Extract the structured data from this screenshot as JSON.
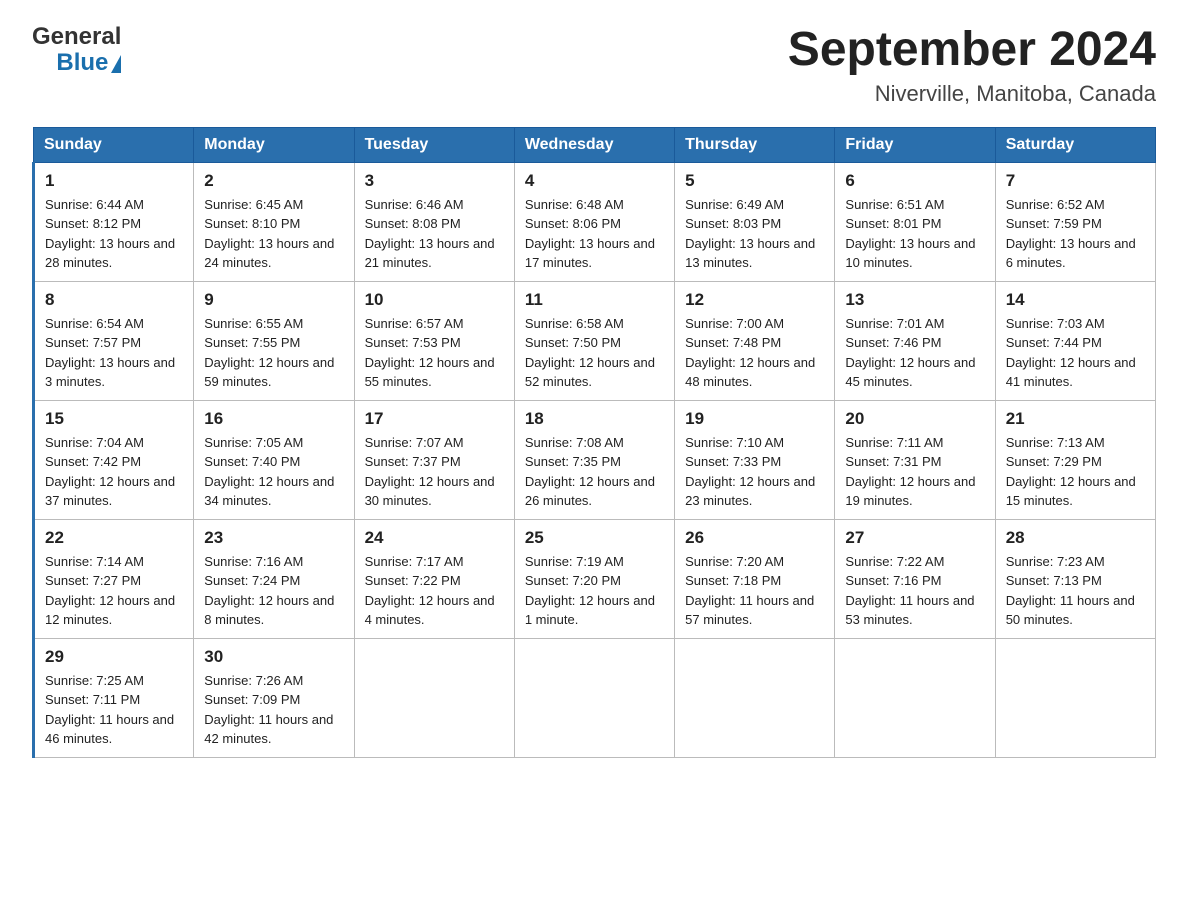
{
  "header": {
    "logo_general": "General",
    "logo_blue": "Blue",
    "month_year": "September 2024",
    "location": "Niverville, Manitoba, Canada"
  },
  "weekdays": [
    "Sunday",
    "Monday",
    "Tuesday",
    "Wednesday",
    "Thursday",
    "Friday",
    "Saturday"
  ],
  "weeks": [
    [
      {
        "day": "1",
        "sunrise": "6:44 AM",
        "sunset": "8:12 PM",
        "daylight": "13 hours and 28 minutes."
      },
      {
        "day": "2",
        "sunrise": "6:45 AM",
        "sunset": "8:10 PM",
        "daylight": "13 hours and 24 minutes."
      },
      {
        "day": "3",
        "sunrise": "6:46 AM",
        "sunset": "8:08 PM",
        "daylight": "13 hours and 21 minutes."
      },
      {
        "day": "4",
        "sunrise": "6:48 AM",
        "sunset": "8:06 PM",
        "daylight": "13 hours and 17 minutes."
      },
      {
        "day": "5",
        "sunrise": "6:49 AM",
        "sunset": "8:03 PM",
        "daylight": "13 hours and 13 minutes."
      },
      {
        "day": "6",
        "sunrise": "6:51 AM",
        "sunset": "8:01 PM",
        "daylight": "13 hours and 10 minutes."
      },
      {
        "day": "7",
        "sunrise": "6:52 AM",
        "sunset": "7:59 PM",
        "daylight": "13 hours and 6 minutes."
      }
    ],
    [
      {
        "day": "8",
        "sunrise": "6:54 AM",
        "sunset": "7:57 PM",
        "daylight": "13 hours and 3 minutes."
      },
      {
        "day": "9",
        "sunrise": "6:55 AM",
        "sunset": "7:55 PM",
        "daylight": "12 hours and 59 minutes."
      },
      {
        "day": "10",
        "sunrise": "6:57 AM",
        "sunset": "7:53 PM",
        "daylight": "12 hours and 55 minutes."
      },
      {
        "day": "11",
        "sunrise": "6:58 AM",
        "sunset": "7:50 PM",
        "daylight": "12 hours and 52 minutes."
      },
      {
        "day": "12",
        "sunrise": "7:00 AM",
        "sunset": "7:48 PM",
        "daylight": "12 hours and 48 minutes."
      },
      {
        "day": "13",
        "sunrise": "7:01 AM",
        "sunset": "7:46 PM",
        "daylight": "12 hours and 45 minutes."
      },
      {
        "day": "14",
        "sunrise": "7:03 AM",
        "sunset": "7:44 PM",
        "daylight": "12 hours and 41 minutes."
      }
    ],
    [
      {
        "day": "15",
        "sunrise": "7:04 AM",
        "sunset": "7:42 PM",
        "daylight": "12 hours and 37 minutes."
      },
      {
        "day": "16",
        "sunrise": "7:05 AM",
        "sunset": "7:40 PM",
        "daylight": "12 hours and 34 minutes."
      },
      {
        "day": "17",
        "sunrise": "7:07 AM",
        "sunset": "7:37 PM",
        "daylight": "12 hours and 30 minutes."
      },
      {
        "day": "18",
        "sunrise": "7:08 AM",
        "sunset": "7:35 PM",
        "daylight": "12 hours and 26 minutes."
      },
      {
        "day": "19",
        "sunrise": "7:10 AM",
        "sunset": "7:33 PM",
        "daylight": "12 hours and 23 minutes."
      },
      {
        "day": "20",
        "sunrise": "7:11 AM",
        "sunset": "7:31 PM",
        "daylight": "12 hours and 19 minutes."
      },
      {
        "day": "21",
        "sunrise": "7:13 AM",
        "sunset": "7:29 PM",
        "daylight": "12 hours and 15 minutes."
      }
    ],
    [
      {
        "day": "22",
        "sunrise": "7:14 AM",
        "sunset": "7:27 PM",
        "daylight": "12 hours and 12 minutes."
      },
      {
        "day": "23",
        "sunrise": "7:16 AM",
        "sunset": "7:24 PM",
        "daylight": "12 hours and 8 minutes."
      },
      {
        "day": "24",
        "sunrise": "7:17 AM",
        "sunset": "7:22 PM",
        "daylight": "12 hours and 4 minutes."
      },
      {
        "day": "25",
        "sunrise": "7:19 AM",
        "sunset": "7:20 PM",
        "daylight": "12 hours and 1 minute."
      },
      {
        "day": "26",
        "sunrise": "7:20 AM",
        "sunset": "7:18 PM",
        "daylight": "11 hours and 57 minutes."
      },
      {
        "day": "27",
        "sunrise": "7:22 AM",
        "sunset": "7:16 PM",
        "daylight": "11 hours and 53 minutes."
      },
      {
        "day": "28",
        "sunrise": "7:23 AM",
        "sunset": "7:13 PM",
        "daylight": "11 hours and 50 minutes."
      }
    ],
    [
      {
        "day": "29",
        "sunrise": "7:25 AM",
        "sunset": "7:11 PM",
        "daylight": "11 hours and 46 minutes."
      },
      {
        "day": "30",
        "sunrise": "7:26 AM",
        "sunset": "7:09 PM",
        "daylight": "11 hours and 42 minutes."
      },
      null,
      null,
      null,
      null,
      null
    ]
  ],
  "labels": {
    "sunrise": "Sunrise:",
    "sunset": "Sunset:",
    "daylight": "Daylight:"
  }
}
